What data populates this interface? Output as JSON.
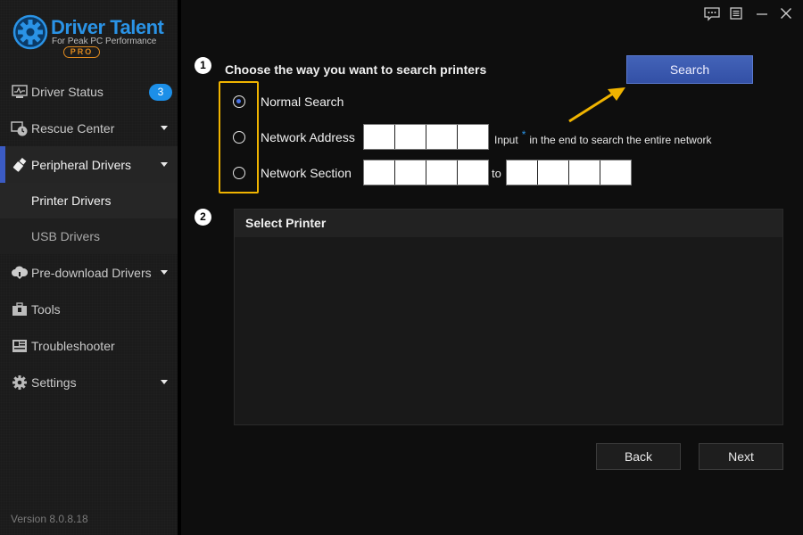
{
  "app": {
    "brand": "Driver Talent",
    "tagline": "For Peak PC Performance",
    "edition": "PRO",
    "version": "Version 8.0.8.18"
  },
  "window_controls": [
    {
      "name": "feedback",
      "icon": "chat-bubble-icon"
    },
    {
      "name": "menu",
      "icon": "list-icon"
    },
    {
      "name": "minimize",
      "icon": "minimize-icon"
    },
    {
      "name": "close",
      "icon": "close-icon"
    }
  ],
  "sidebar": {
    "items": [
      {
        "label": "Driver Status",
        "icon": "monitor-icon",
        "badge": "3"
      },
      {
        "label": "Rescue Center",
        "icon": "clock-restore-icon",
        "expandable": true
      },
      {
        "label": "Peripheral Drivers",
        "icon": "usb-icon",
        "expandable": true,
        "active": true,
        "children": [
          {
            "label": "Printer Drivers",
            "selected": true
          },
          {
            "label": "USB Drivers"
          }
        ]
      },
      {
        "label": "Pre-download Drivers",
        "icon": "cloud-download-icon",
        "expandable": true
      },
      {
        "label": "Tools",
        "icon": "toolbox-icon"
      },
      {
        "label": "Troubleshooter",
        "icon": "troubleshooter-icon"
      },
      {
        "label": "Settings",
        "icon": "gear-icon",
        "expandable": true
      }
    ]
  },
  "main": {
    "step1": {
      "number": "1",
      "title": "Choose the way you want to search printers",
      "search_button": "Search",
      "options": [
        {
          "label": "Normal Search",
          "checked": true
        },
        {
          "label": "Network Address",
          "checked": false
        },
        {
          "label": "Network Section",
          "checked": false
        }
      ],
      "hint_prefix": "Input",
      "hint_symbol": "*",
      "hint_suffix": "in the end to search the entire network",
      "to_label": "to"
    },
    "step2": {
      "number": "2",
      "title": "Select Printer"
    },
    "buttons": {
      "back": "Back",
      "next": "Next"
    }
  },
  "colors": {
    "accent": "#3b5bc4",
    "brand_blue": "#2a93e6",
    "highlight": "#f0b400",
    "pro_orange": "#e08a1e"
  }
}
